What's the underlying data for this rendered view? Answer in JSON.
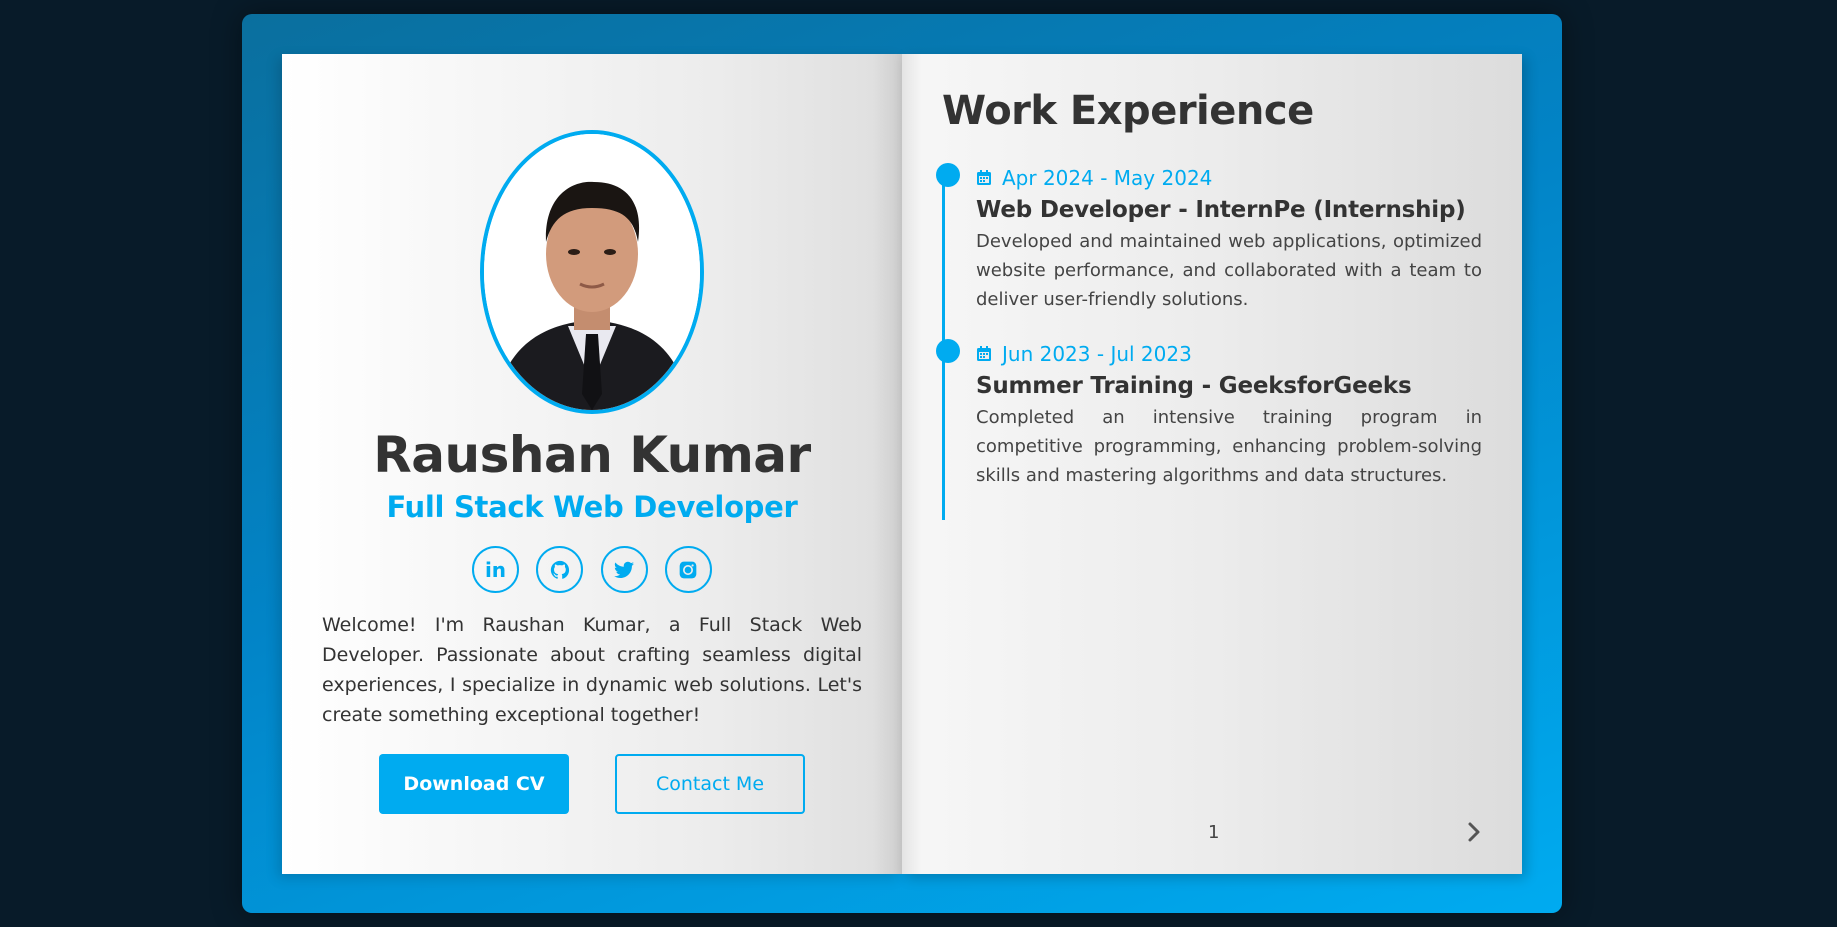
{
  "profile": {
    "name": "Raushan Kumar",
    "role": "Full Stack Web Developer",
    "bio": "Welcome! I'm Raushan Kumar, a Full Stack Web Developer. Passionate about crafting seamless digital experiences, I specialize in dynamic web solutions. Let's create something exceptional together!",
    "socials": [
      {
        "icon": "linkedin-icon",
        "glyph": "in"
      },
      {
        "icon": "github-icon",
        "glyph": ""
      },
      {
        "icon": "twitter-icon",
        "glyph": ""
      },
      {
        "icon": "instagram-icon",
        "glyph": ""
      }
    ],
    "buttons": {
      "download_cv": "Download CV",
      "contact_me": "Contact Me"
    }
  },
  "experience": {
    "title": "Work Experience",
    "items": [
      {
        "date": "Apr 2024 - May 2024",
        "title": "Web Developer - InternPe (Internship)",
        "description": "Developed and maintained web applications, optimized website performance, and collaborated with a team to deliver user-friendly solutions."
      },
      {
        "date": "Jun 2023 - Jul 2023",
        "title": "Summer Training - GeeksforGeeks",
        "description": "Completed an intensive training program in competitive programming, enhancing problem-solving skills and mastering algorithms and data structures."
      }
    ]
  },
  "pagination": {
    "page": "1",
    "next_icon": "chevron-right-icon"
  },
  "colors": {
    "accent": "#00abf0",
    "background": "#081b29",
    "text": "#333333"
  }
}
